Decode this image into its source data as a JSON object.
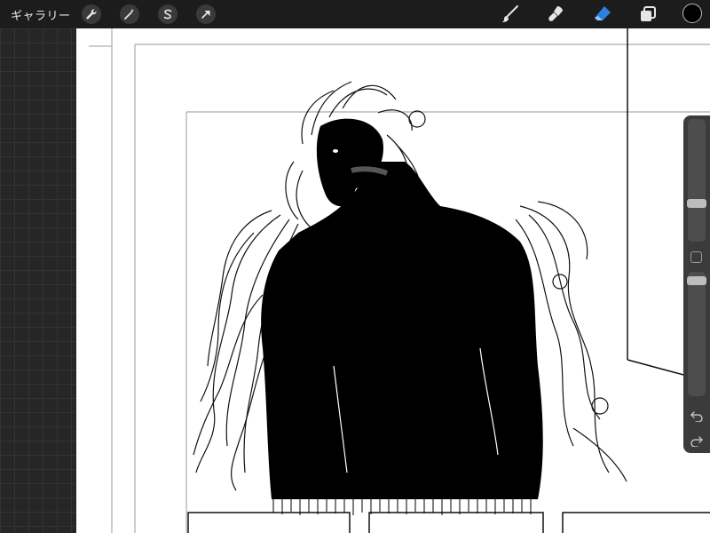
{
  "toolbar": {
    "gallery_label": "ギャラリー",
    "left_tools": [
      "wrench-icon",
      "magic-wand-icon",
      "selection-icon",
      "transform-arrow-icon"
    ],
    "right_tools": [
      "brush-icon",
      "smudge-icon",
      "eraser-icon",
      "layers-icon"
    ],
    "active_tool": "eraser-icon",
    "active_color": "#000000",
    "accent_color": "#2f7fe0"
  },
  "sidebar": {
    "size_slider_level": 0.3,
    "opacity_slider_level": 0.04,
    "buttons": [
      "modify-button",
      "undo-icon",
      "redo-icon"
    ]
  }
}
